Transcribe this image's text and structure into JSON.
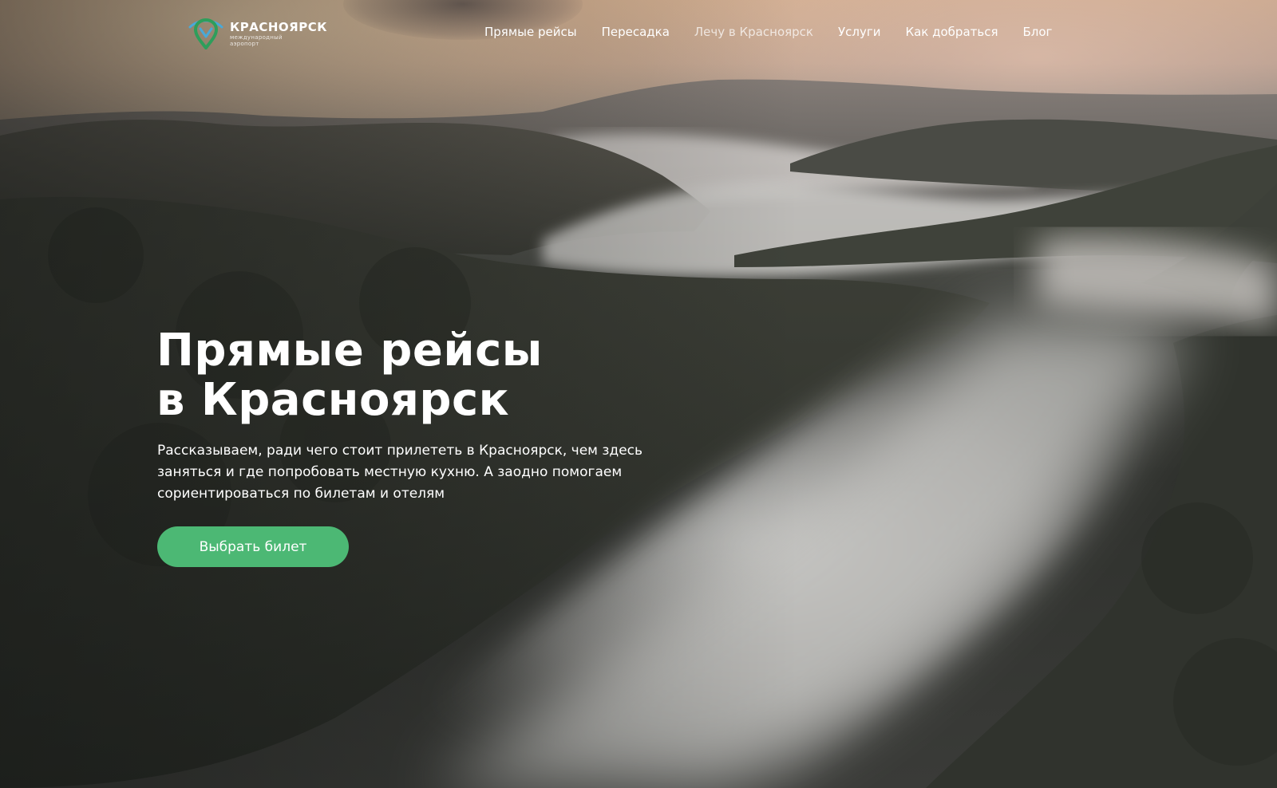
{
  "brand": {
    "name": "КРАСНОЯРСК",
    "subtitle_line1": "международный",
    "subtitle_line2": "аэропорт",
    "colors": {
      "accent_green": "#4cb874",
      "logo_green": "#2e9e5b",
      "logo_blue": "#49a9d8"
    },
    "icon": "map-pin-logo-icon"
  },
  "nav": {
    "items": [
      {
        "label": "Прямые рейсы",
        "active": false
      },
      {
        "label": "Пересадка",
        "active": false
      },
      {
        "label": "Лечу в Красноярск",
        "active": true
      },
      {
        "label": "Услуги",
        "active": false
      },
      {
        "label": "Как добраться",
        "active": false
      },
      {
        "label": "Блог",
        "active": false
      }
    ]
  },
  "hero": {
    "title_line1": "Прямые рейсы",
    "title_line2": "в Красноярск",
    "lead_line1": "Рассказываем, ради чего стоит прилететь в Красноярск, чем здесь",
    "lead_line2": "заняться и где попробовать местную кухню. А заодно помогаем",
    "lead_line3": "сориентироваться по билетам и отелям",
    "cta_label": "Выбрать билет",
    "background": "aerial photo of forested mountains with fog in the valley at sunrise"
  }
}
